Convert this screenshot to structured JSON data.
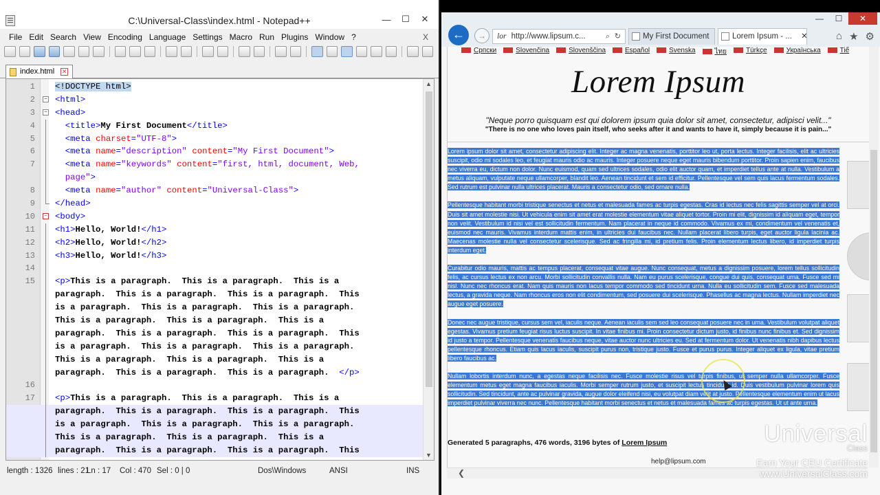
{
  "notepad": {
    "title": "C:\\Universal-Class\\index.html - Notepad++",
    "window_buttons": [
      "—",
      "☐",
      "✕"
    ],
    "menu": [
      "File",
      "Edit",
      "Search",
      "View",
      "Encoding",
      "Language",
      "Settings",
      "Macro",
      "Run",
      "Plugins",
      "Window",
      "?"
    ],
    "menu_close": "X",
    "tab_label": "index.html",
    "tab_close": "✕",
    "code_lines": [
      {
        "n": "1",
        "html": "<span class=\"t-doc\">&lt;!DOCTYPE html&gt;</span>"
      },
      {
        "n": "2",
        "html": "<span class=\"t-tag\">&lt;html&gt;</span>"
      },
      {
        "n": "3",
        "html": "<span class=\"t-tag\">&lt;head&gt;</span>"
      },
      {
        "n": "4",
        "html": "  <span class=\"t-tag\">&lt;title&gt;</span><span class=\"t-txt\">My First Document</span><span class=\"t-tag\">&lt;/title&gt;</span>"
      },
      {
        "n": "5",
        "html": "  <span class=\"t-tag\">&lt;meta</span> <span class=\"t-attr\">charset</span><span class=\"t-tag\">=</span><span class=\"t-val\">\"UTF-8\"</span><span class=\"t-tag\">&gt;</span>"
      },
      {
        "n": "6",
        "html": "  <span class=\"t-tag\">&lt;meta</span> <span class=\"t-attr\">name</span><span class=\"t-tag\">=</span><span class=\"t-val\">\"description\"</span> <span class=\"t-attr\">content</span><span class=\"t-tag\">=</span><span class=\"t-val\">\"My First Document\"</span><span class=\"t-tag\">&gt;</span>"
      },
      {
        "n": "7",
        "html": "  <span class=\"t-tag\">&lt;meta</span> <span class=\"t-attr\">name</span><span class=\"t-tag\">=</span><span class=\"t-val\">\"keywords\"</span> <span class=\"t-attr\">content</span><span class=\"t-tag\">=</span><span class=\"t-val\">\"first, html, document, Web,</span>"
      },
      {
        "n": "",
        "html": "  <span class=\"t-val\">page\"</span><span class=\"t-tag\">&gt;</span>"
      },
      {
        "n": "8",
        "html": "  <span class=\"t-tag\">&lt;meta</span> <span class=\"t-attr\">name</span><span class=\"t-tag\">=</span><span class=\"t-val\">\"author\"</span> <span class=\"t-attr\">content</span><span class=\"t-tag\">=</span><span class=\"t-val\">\"Universal-Class\"</span><span class=\"t-tag\">&gt;</span>"
      },
      {
        "n": "9",
        "html": "<span class=\"t-tag\">&lt;/head&gt;</span>"
      },
      {
        "n": "10",
        "html": "<span class=\"t-tag\">&lt;body&gt;</span>"
      },
      {
        "n": "11",
        "html": "<span class=\"t-tag\">&lt;h1&gt;</span><span class=\"t-txt\">Hello, World!</span><span class=\"t-tag\">&lt;/h1&gt;</span>"
      },
      {
        "n": "12",
        "html": "<span class=\"t-tag\">&lt;h2&gt;</span><span class=\"t-txt\">Hello, World!</span><span class=\"t-tag\">&lt;/h2&gt;</span>"
      },
      {
        "n": "13",
        "html": "<span class=\"t-tag\">&lt;h3&gt;</span><span class=\"t-txt\">Hello, World!</span><span class=\"t-tag\">&lt;/h3&gt;</span>"
      },
      {
        "n": "14",
        "html": ""
      },
      {
        "n": "15",
        "html": "<span class=\"t-tag\">&lt;p&gt;</span><span class=\"t-txt\">This is a paragraph.  This is a paragraph.  This is a</span>"
      },
      {
        "n": "",
        "html": "<span class=\"t-txt\">paragraph.  This is a paragraph.  This is a paragraph.  This</span>"
      },
      {
        "n": "",
        "html": "<span class=\"t-txt\">is a paragraph.  This is a paragraph.  This is a paragraph.</span>"
      },
      {
        "n": "",
        "html": "<span class=\"t-txt\">This is a paragraph.  This is a paragraph.  This is a</span>"
      },
      {
        "n": "",
        "html": "<span class=\"t-txt\">paragraph.  This is a paragraph.  This is a paragraph.  This</span>"
      },
      {
        "n": "",
        "html": "<span class=\"t-txt\">is a paragraph.  This is a paragraph.  This is a paragraph.</span>"
      },
      {
        "n": "",
        "html": "<span class=\"t-txt\">This is a paragraph.  This is a paragraph.  This is a</span>"
      },
      {
        "n": "",
        "html": "<span class=\"t-txt\">paragraph.  This is a paragraph.  This is a paragraph.  </span><span class=\"t-tag\">&lt;/p&gt;</span>"
      },
      {
        "n": "16",
        "html": ""
      },
      {
        "n": "17",
        "html": "<span class=\"t-tag\">&lt;p&gt;</span><span class=\"t-txt\">This is a paragraph.  This is a paragraph.  This is a</span>"
      },
      {
        "n": "",
        "html": "<span class=\"t-txt\">paragraph.  This is a paragraph.  This is a paragraph.  This</span>"
      },
      {
        "n": "",
        "html": "<span class=\"t-txt\">is a paragraph.  This is a paragraph.  This is a paragraph.</span>"
      },
      {
        "n": "",
        "html": "<span class=\"t-txt\">This is a paragraph.  This is a paragraph.  This is a</span>"
      },
      {
        "n": "",
        "html": "<span class=\"t-txt\">paragraph.  This is a paragraph.  This is a paragraph.  This</span>"
      }
    ],
    "status": {
      "length": "length : 1326",
      "lines": "lines : 21",
      "ln": "Ln : 17",
      "col": "Col : 470",
      "sel": "Sel : 0 | 0",
      "eol": "Dos\\Windows",
      "encoding": "ANSI",
      "mode": "INS"
    }
  },
  "browser": {
    "window_buttons": [
      "—",
      "☐",
      "✕"
    ],
    "address_favicon": "lor",
    "address": "http://www.lipsum.c...",
    "address_search_icon": "⌕",
    "address_refresh_icon": "↻",
    "tabs": [
      {
        "label": "My First Document"
      },
      {
        "label": "Lorem Ipsum - ...",
        "close": "✕"
      }
    ],
    "toolbar_icons": [
      "⌂",
      "★",
      "⚙"
    ],
    "languages": [
      "Српски",
      "Slovenčina",
      "Slovenščina",
      "Español",
      "Svenska",
      "ไทย",
      "Türkçe",
      "Українська",
      "Tiế"
    ],
    "page_title": "Lorem Ipsum",
    "quote_latin": "\"Neque porro quisquam est qui dolorem ipsum quia dolor sit amet, consectetur, adipisci velit...\"",
    "quote_english": "\"There is no one who loves pain itself, who seeks after it and wants to have it, simply because it is pain...\"",
    "paragraphs": [
      "Lorem ipsum dolor sit amet, consectetur adipiscing elit. Integer ac magna venenatis, porttitor leo ut, porta lectus. Integer facilisis, elit ac ultricies suscipit, odio mi sodales leo, et feugiat mauris odio ac mauris. Integer posuere neque eget mauris bibendum porttitor. Proin sapien enim, faucibus nec viverra eu, dictum non dolor. Nunc euismod, quam sed ultrices sodales, odio elit auctor quam, et imperdiet tellus ante at nulla. Vestibulum a metus aliquam, vulputate neque ullamcorper, blandit leo. Aenean tincidunt et sem id efficitur. Pellentesque vel sem quis lacus fermentum sodales. Sed rutrum est pulvinar nulla ultrices placerat. Mauris a consectetur odio, sed ornare nulla.",
      "Pellentesque habitant morbi tristique senectus et netus et malesuada fames ac turpis egestas. Cras id lectus nec felis sagittis semper vel at orci. Duis sit amet molestie nisi. Ut vehicula enim sit amet erat molestie elementum vitae aliquet tortor. Proin mi elit, dignissim id aliquam eget, tempor non velit. Vestibulum id nisi vel est sollicitudin fermentum. Nam placerat in neque id commodo. Vivamus ex mi, condimentum vel venenatis et, euismod nec mauris. Vivamus interdum mattis enim, in ultricies dui faucibus nec. Nullam placerat libero turpis, eget auctor ligula lacinia ac. Maecenas molestie nulla vel consectetur scelerisque. Sed ac fringilla mi, id pretium felis. Proin elementum lectus libero, id imperdiet turpis interdum eget.",
      "Curabitur odio mauris, mattis ac tempus placerat, consequat vitae augue. Nunc consequat, metus a dignissim posuere, lorem tellus sollicitudin felis, ac cursus lectus ex non arcu. Morbi sollicitudin convallis nulla. Nam eu purus scelerisque, congue dui quis, consequat urna. Fusce sed mi nisl. Nunc nec rhoncus erat. Nam quis mauris non lacus tempor commodo sed tincidunt urna. Nulla eu sollicitudin sem. Fusce sed malesuada lectus, a gravida neque. Nam rhoncus eros non elit condimentum, sed posuere dui scelerisque. Phasellus ac magna lectus. Nullam imperdiet nec augue eget posuere.",
      "Donec nec augue tristique, cursus sem vel, iaculis neque. Aenean iaculis sem sed leo consequat posuere nec in urna. Vestibulum volutpat aliquet egestas. Vivamus pretium feugiat risus luctus suscipit. In vitae finibus mi. Proin consectetur dictum justo, id finibus nunc finibus et. Sed dignissim id justo a tempor. Pellentesque venenatis faucibus neque, vitae auctor nunc ultricies eu. Sed at fermentum dolor. Ut venenatis nibh dapibus lectus pellentesque rhoncus. Etiam quis lacus iaculis, suscipit purus non, tristique justo. Fusce et purus purus. Integer aliquet ex ligula, vitae pretium libero faucibus ac.",
      "Nullam lobortis interdum nunc, a egestas neque facilisis nec. Fusce molestie risus vel turpis finibus, ut semper nulla ullamcorper. Fusce elementum metus eget magna faucibus iaculis. Morbi semper rutrum justo, et suscipit lectus tincidunt id. Duis vestibulum pulvinar lorem quis sollicitudin. Sed tincidunt, ante ac pulvinar gravida, augue dolor eleifend nisi, eu volutpat diam velit at justo. Pellentesque elementum enim ut lacus imperdiet pulvinar viverra nec nunc. Pellentesque habitant morbi senectus et netus et malesuada fames ac turpis egestas. Ut ut ante urna."
    ],
    "generated_prefix": "Generated 5 paragraphs, 476 words, 3196 bytes of ",
    "generated_link": "Lorem Ipsum",
    "email": "help@lipsum.com",
    "scroll_left": "❮"
  },
  "watermark": {
    "brand": "Universal",
    "sub": "Class",
    "line1": "Earn Your CEU Certificate",
    "line2": "www.UniversalClass.com"
  },
  "colors": {
    "selection": "#3b78d6",
    "tag": "#0000ff",
    "attr": "#ff0000",
    "value": "#8000ff",
    "back_button": "#1c6cc4"
  }
}
